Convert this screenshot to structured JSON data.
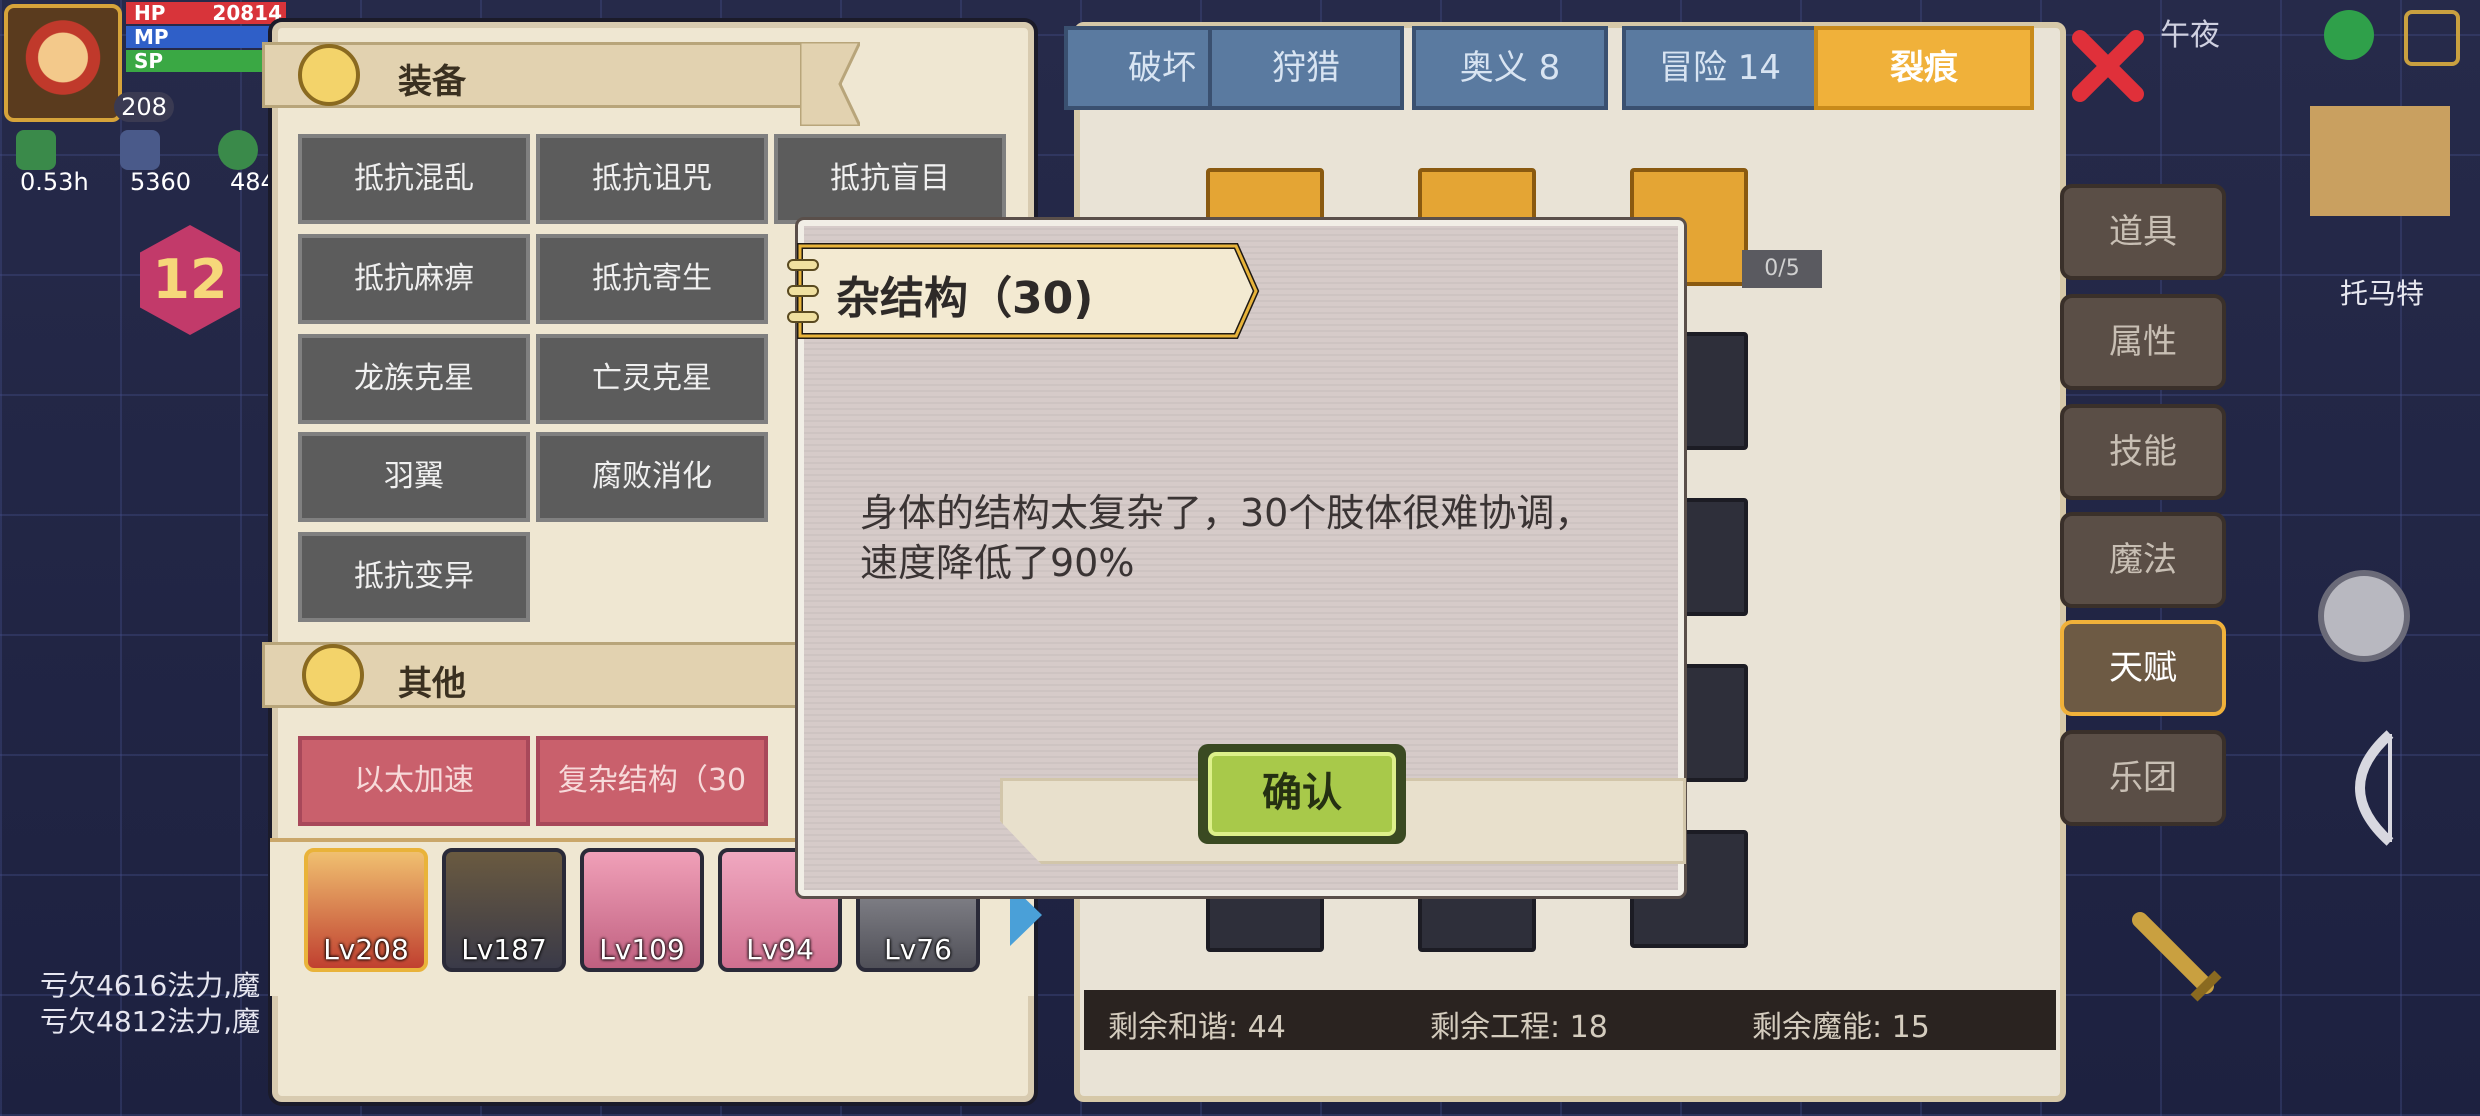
{
  "player": {
    "level": "208",
    "hp_label": "HP",
    "hp_value": "20814",
    "mp_label": "MP",
    "sp_label": "SP",
    "stats": [
      "0.53h",
      "5360",
      "484"
    ],
    "hex_level": "12",
    "debt_lines": [
      "亏欠4616法力,魔",
      "亏欠4812法力,魔"
    ]
  },
  "left_panel": {
    "equip_title": "装备",
    "equip_tiles": [
      "抵抗混乱",
      "抵抗诅咒",
      "抵抗盲目",
      "抵抗麻痹",
      "抵抗寄生",
      "龙族克星",
      "亡灵克星",
      "羽翼",
      "腐败消化",
      "抵抗变异"
    ],
    "other_title": "其他",
    "other_tiles": [
      "以太加速",
      "复杂结构（30"
    ]
  },
  "team": [
    {
      "lv": "Lv208"
    },
    {
      "lv": "Lv187"
    },
    {
      "lv": "Lv109"
    },
    {
      "lv": "Lv94"
    },
    {
      "lv": "Lv76"
    }
  ],
  "tabs": [
    "破坏",
    "狩猎",
    "奥义 8",
    "冒险 14",
    "裂痕"
  ],
  "skill_counter": "0/5",
  "footer": {
    "harmony": "剩余和谐: 44",
    "engineering": "剩余工程: 18",
    "magic": "剩余魔能: 15"
  },
  "side_menu": [
    "道具",
    "属性",
    "技能",
    "魔法",
    "天赋",
    "乐团"
  ],
  "minimap_label": "托马特",
  "time_label": "午夜",
  "dialog": {
    "title": "杂结构（30)",
    "body": "身体的结构太复杂了，30个肢体很难协调，速度降低了90%",
    "confirm": "确认"
  },
  "colors": {
    "accent": "#f0b13a",
    "confirm": "#a8c94a",
    "close": "#e0303a"
  }
}
